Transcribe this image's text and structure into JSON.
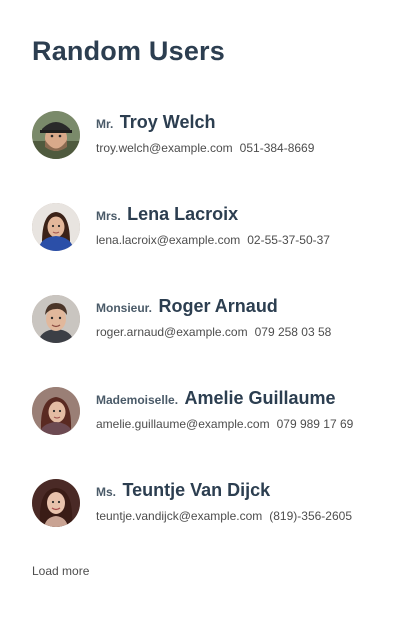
{
  "page": {
    "title": "Random Users",
    "load_more_label": "Load more"
  },
  "users": [
    {
      "title": "Mr.",
      "name": "Troy Welch",
      "email": "troy.welch@example.com",
      "phone": "051-384-8669",
      "avatar_icon": "avatar-man-cap-beard"
    },
    {
      "title": "Mrs.",
      "name": "Lena Lacroix",
      "email": "lena.lacroix@example.com",
      "phone": "02-55-37-50-37",
      "avatar_icon": "avatar-woman-dark-hair"
    },
    {
      "title": "Monsieur.",
      "name": "Roger Arnaud",
      "email": "roger.arnaud@example.com",
      "phone": "079 258 03 58",
      "avatar_icon": "avatar-man-short-hair"
    },
    {
      "title": "Mademoiselle.",
      "name": "Amelie Guillaume",
      "email": "amelie.guillaume@example.com",
      "phone": "079 989 17 69",
      "avatar_icon": "avatar-woman-brown-hair"
    },
    {
      "title": "Ms.",
      "name": "Teuntje Van Dijck",
      "email": "teuntje.vandijck@example.com",
      "phone": "(819)-356-2605",
      "avatar_icon": "avatar-woman-long-hair"
    }
  ],
  "colors": {
    "heading": "#2c3e50",
    "subtitle": "#4a5a68",
    "body_text": "#4d4d4d"
  }
}
